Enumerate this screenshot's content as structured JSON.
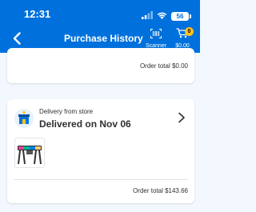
{
  "status_bar": {
    "time": "12:31",
    "battery": "56"
  },
  "header": {
    "title": "Purchase History",
    "scanner_label": "Scanner",
    "cart_count": "0",
    "cart_total": "$0.00"
  },
  "orders": [
    {
      "order_total": "Order total $0.00"
    },
    {
      "fulfillment_type": "Delivery from store",
      "status": "Delivered on Nov 06",
      "order_total": "Order total $143.66"
    }
  ],
  "colors": {
    "header_bg": "#0071dc",
    "background": "#f2f8fd",
    "badge": "#ffc220"
  }
}
